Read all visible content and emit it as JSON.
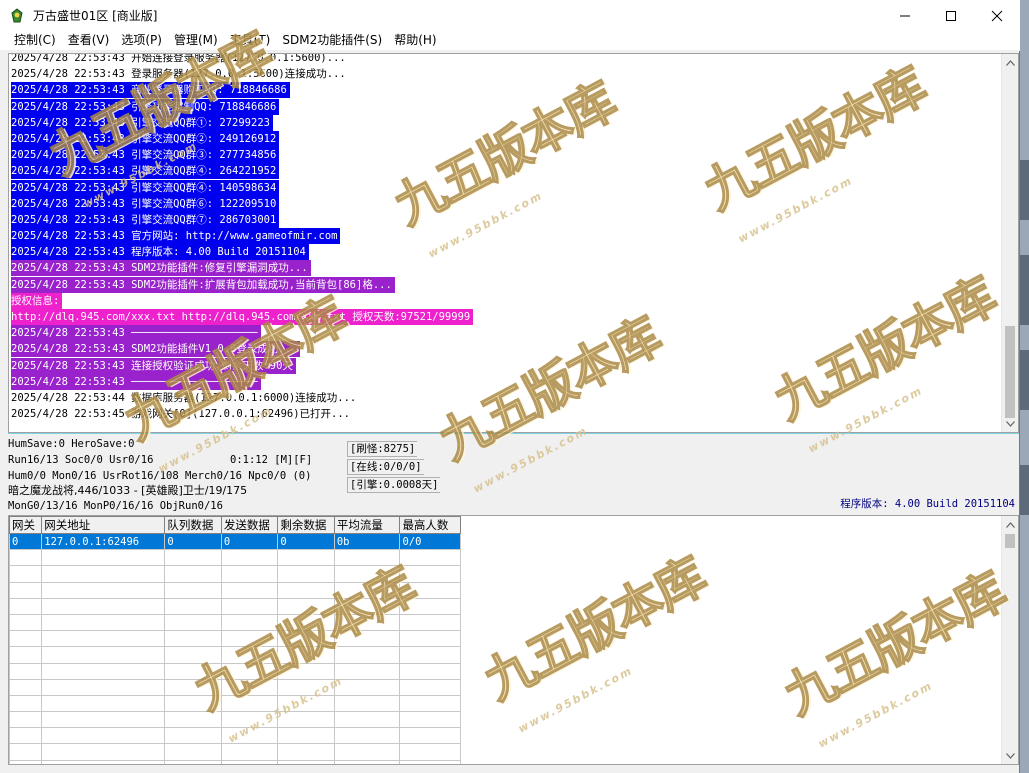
{
  "window": {
    "title": "万古盛世01区 [商业版]",
    "controls": {
      "minimize": "minimize-icon",
      "maximize": "maximize-icon",
      "close": "close-icon"
    }
  },
  "menu": [
    "控制(C)",
    "查看(V)",
    "选项(P)",
    "管理(M)",
    "工具(T)",
    "SDM2功能插件(S)",
    "帮助(H)"
  ],
  "log": [
    {
      "style": "plain",
      "text": "2025/4/28 22:53:43 开始连接登录服务器(127.0.0.1:5600)..."
    },
    {
      "style": "plain",
      "text": "2025/4/28 22:53:43 登录服务器(127.0.0.1:5600)连接成功..."
    },
    {
      "style": "blue",
      "text": "2025/4/28 22:53:43 商业登录器购买QQ: 718846686"
    },
    {
      "style": "blue",
      "text": "2025/4/28 22:53:43 引擎功能定制QQ: 718846686"
    },
    {
      "style": "blue",
      "text": "2025/4/28 22:53:43 引擎交流QQ群①: 27299223"
    },
    {
      "style": "blue",
      "text": "2025/4/28 22:53:43 引擎交流QQ群②: 249126912"
    },
    {
      "style": "blue",
      "text": "2025/4/28 22:53:43 引擎交流QQ群③: 277734856"
    },
    {
      "style": "blue",
      "text": "2025/4/28 22:53:43 引擎交流QQ群④: 264221952"
    },
    {
      "style": "blue",
      "text": "2025/4/28 22:53:43 引擎交流QQ群④: 140598634"
    },
    {
      "style": "blue",
      "text": "2025/4/28 22:53:43 引擎交流QQ群⑥: 122209510"
    },
    {
      "style": "blue",
      "text": "2025/4/28 22:53:43 引擎交流QQ群⑦: 286703001"
    },
    {
      "style": "blue",
      "text": "2025/4/28 22:53:43 官方网站: http://www.gameofmir.com"
    },
    {
      "style": "blue",
      "text": "2025/4/28 22:53:43 程序版本: 4.00 Build 20151104"
    },
    {
      "style": "purple",
      "text": "2025/4/28 22:53:43 SDM2功能插件:修复引擎漏洞成功..."
    },
    {
      "style": "purple",
      "text": "2025/4/28 22:53:43 SDM2功能插件:扩展背包加载成功,当前背包[86]格..."
    },
    {
      "style": "magenta",
      "text": "授权信息:"
    },
    {
      "style": "magenta",
      "text": "http://dlq.945.com/xxx.txt http://dlq.945.com/xxx.txt 授权天数:97521/99999"
    },
    {
      "style": "purple",
      "text": "2025/4/28 22:53:43 ────────────────────"
    },
    {
      "style": "purple",
      "text": "2025/4/28 22:53:43 SDM2功能插件V1.0.8登录成功..."
    },
    {
      "style": "purple",
      "text": "2025/4/28 22:53:43 连接授权验证成功,剩余天数:90天"
    },
    {
      "style": "purple",
      "text": "2025/4/28 22:53:43 ────────────────────"
    },
    {
      "style": "plain",
      "text": "2025/4/28 22:53:44 数据库服务器(127.0.0.1:6000)连接成功..."
    },
    {
      "style": "plain",
      "text": "2025/4/28 22:53:45 游戏网关[0](127.0.0.1:62496)已打开..."
    }
  ],
  "status": {
    "line1": "HumSave:0 HeroSave:0",
    "line2": "Run16/13 Soc0/0 Usr0/16",
    "time": "0:1:12 [M][F]",
    "line3": "Hum0/0 Mon0/16 UsrRot16/108 Merch0/16 Npc0/0 (0)",
    "line4": "暗之魔龙战将,446/1033 - [英雄殿]卫士/19/175",
    "line5": "MonG0/13/16 MonP0/16/16 ObjRun0/16",
    "refresh": "[刷怪:8275]",
    "online": "[在线:0/0/0]",
    "engine": "[引擎:0.0008天]",
    "version": "程序版本: 4.00 Build 20151104"
  },
  "table": {
    "columns": [
      "网关",
      "网关地址",
      "队列数据",
      "发送数据",
      "剩余数据",
      "平均流量",
      "最高人数"
    ],
    "rows": [
      [
        "0",
        "127.0.0.1:62496",
        "0",
        "0",
        "0",
        "0b",
        "0/0"
      ]
    ],
    "empty_rows": 14
  },
  "watermark": {
    "brand": "九五版本库",
    "url": "www.95bbk.com"
  },
  "colors": {
    "log_blue": "#0000ee",
    "log_purple": "#9922cc",
    "log_magenta": "#ee22cc",
    "selection": "#0078d7",
    "version_text": "#000080"
  }
}
